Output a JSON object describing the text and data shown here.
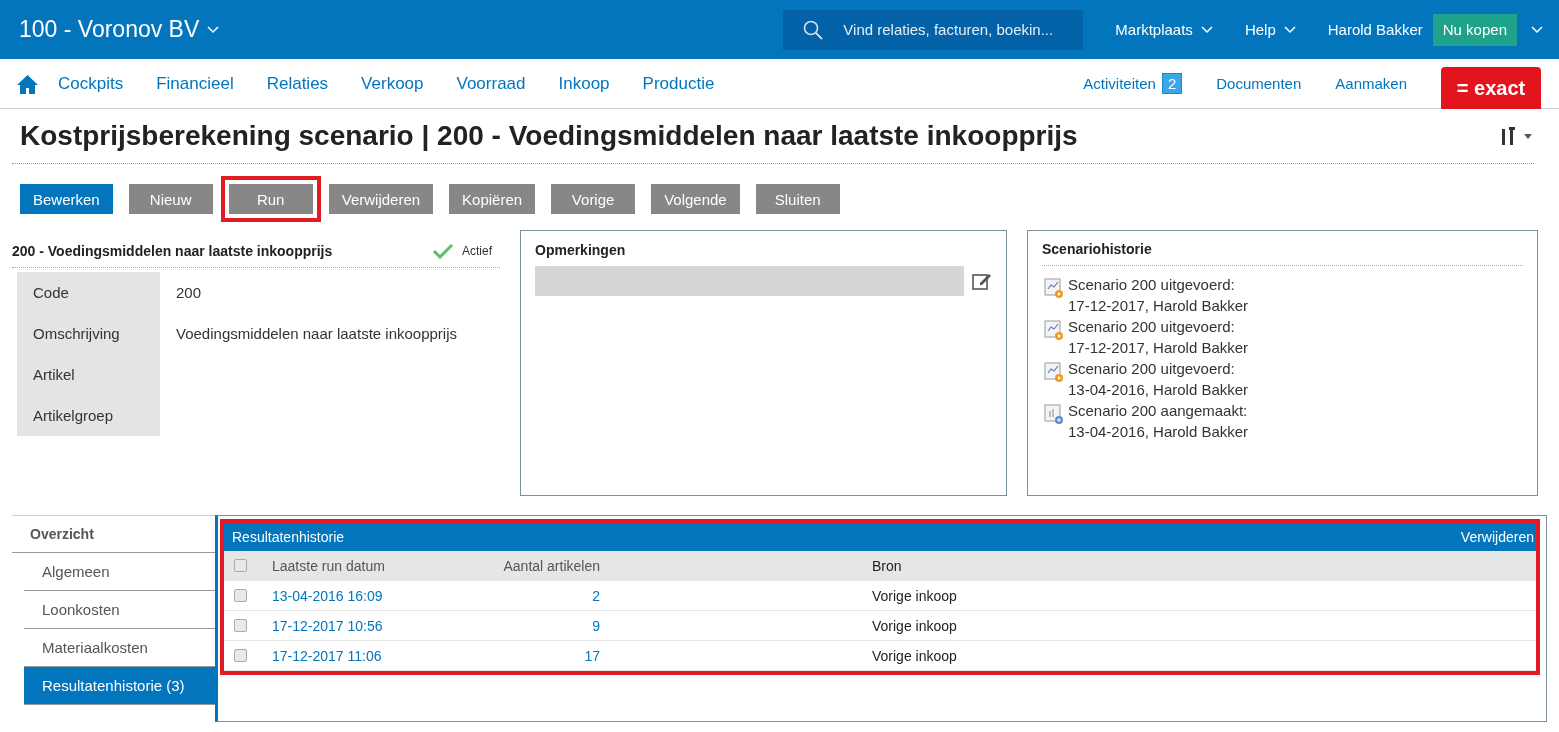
{
  "topbar": {
    "company": "100 - Voronov BV",
    "search": {
      "placeholder": "Vind relaties, facturen, boekin..."
    },
    "menus": [
      "Marktplaats",
      "Help"
    ],
    "user": "Harold Bakker",
    "buy_button": "Nu kopen"
  },
  "nav": {
    "items": [
      "Cockpits",
      "Financieel",
      "Relaties",
      "Verkoop",
      "Voorraad",
      "Inkoop",
      "Productie"
    ],
    "activities": {
      "label": "Activiteiten",
      "count": "2"
    },
    "links": [
      "Documenten",
      "Aanmaken"
    ],
    "logo": "= exact"
  },
  "page": {
    "title": "Kostprijsberekening scenario | 200 - Voedingsmiddelen naar laatste inkoopprijs"
  },
  "buttons": [
    {
      "label": "Bewerken",
      "kind": "primary",
      "highlighted": false
    },
    {
      "label": "Nieuw",
      "kind": "secondary",
      "highlighted": false
    },
    {
      "label": "Run",
      "kind": "secondary",
      "highlighted": true
    },
    {
      "label": "Verwijderen",
      "kind": "secondary",
      "highlighted": false
    },
    {
      "label": "Kopiëren",
      "kind": "secondary",
      "highlighted": false
    },
    {
      "label": "Vorige",
      "kind": "secondary",
      "highlighted": false
    },
    {
      "label": "Volgende",
      "kind": "secondary",
      "highlighted": false
    },
    {
      "label": "Sluiten",
      "kind": "secondary",
      "highlighted": false
    }
  ],
  "details": {
    "title": "200 - Voedingsmiddelen naar laatste inkoopprijs",
    "status": "Actief",
    "active": true,
    "fields": [
      {
        "label": "Code",
        "value": "200"
      },
      {
        "label": "Omschrijving",
        "value": "Voedingsmiddelen naar laatste inkoopprijs"
      },
      {
        "label": "Artikel"
      },
      {
        "label": "Artikelgroep"
      }
    ]
  },
  "remarks": {
    "title": "Opmerkingen"
  },
  "history": {
    "title": "Scenariohistorie",
    "entries": [
      {
        "kind": "run",
        "line1": "Scenario 200 uitgevoerd:",
        "line2": "17-12-2017, Harold Bakker"
      },
      {
        "kind": "run",
        "line1": "Scenario 200 uitgevoerd:",
        "line2": "17-12-2017, Harold Bakker"
      },
      {
        "kind": "run",
        "line1": "Scenario 200 uitgevoerd:",
        "line2": "13-04-2016, Harold Bakker"
      },
      {
        "kind": "created",
        "line1": "Scenario 200 aangemaakt:",
        "line2": "13-04-2016, Harold Bakker"
      }
    ]
  },
  "sidebar": {
    "heading": "Overzicht",
    "items": [
      {
        "label": "Algemeen",
        "selected": false
      },
      {
        "label": "Loonkosten",
        "selected": false
      },
      {
        "label": "Materiaalkosten",
        "selected": false
      },
      {
        "label": "Resultatenhistorie (3)",
        "selected": true
      }
    ]
  },
  "results": {
    "title": "Resultatenhistorie",
    "action": "Verwijderen",
    "highlighted": true,
    "all_checked": false,
    "columns": [
      "Laatste run datum",
      "Aantal artikelen",
      "Bron"
    ],
    "rows": [
      {
        "checked": false,
        "date": "13-04-2016 16:09",
        "count": "2",
        "source": "Vorige inkoop"
      },
      {
        "checked": false,
        "date": "17-12-2017 10:56",
        "count": "9",
        "source": "Vorige inkoop"
      },
      {
        "checked": false,
        "date": "17-12-2017 11:06",
        "count": "17",
        "source": "Vorige inkoop"
      }
    ]
  }
}
